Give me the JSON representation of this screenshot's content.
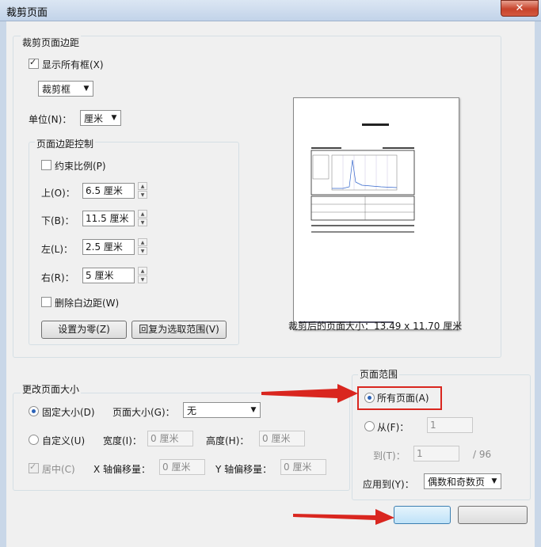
{
  "window": {
    "title": "裁剪页面",
    "close_glyph": "✕"
  },
  "margins_group": {
    "title": "裁剪页面边距",
    "show_all_boxes": {
      "label": "显示所有框(X)",
      "checked": true
    },
    "box_select": {
      "value": "裁剪框"
    },
    "unit": {
      "label": "单位(N)：",
      "value": "厘米"
    }
  },
  "margin_control": {
    "title": "页面边距控制",
    "constrain": {
      "label": "约束比例(P)",
      "checked": false
    },
    "top": {
      "label": "上(O)：",
      "value": "6.5 厘米"
    },
    "bottom": {
      "label": "下(B)：",
      "value": "11.5 厘米"
    },
    "left": {
      "label": "左(L)：",
      "value": "2.5 厘米"
    },
    "right": {
      "label": "右(R)：",
      "value": "5 厘米"
    },
    "remove_white": {
      "label": "删除白边距(W)",
      "checked": false
    },
    "set_zero_button": "设置为零(Z)",
    "revert_button": "回复为选取范围(V)"
  },
  "preview": {
    "size_text": "裁剪后的页面大小：13.49 x 11.70 厘米"
  },
  "resize_group": {
    "title": "更改页面大小",
    "fixed": {
      "label": "固定大小(D)",
      "checked": true
    },
    "page_size": {
      "label": "页面大小(G)：",
      "value": "无"
    },
    "custom": {
      "label": "自定义(U)",
      "checked": false
    },
    "width": {
      "label": "宽度(I)：",
      "value": "0 厘米"
    },
    "height": {
      "label": "高度(H)：",
      "value": "0 厘米"
    },
    "center": {
      "label": "居中(C)",
      "checked": true
    },
    "x_offset": {
      "label": "X 轴偏移量：",
      "value": "0 厘米"
    },
    "y_offset": {
      "label": "Y 轴偏移量：",
      "value": "0 厘米"
    }
  },
  "range_group": {
    "title": "页面范围",
    "all_pages": {
      "label": "所有页面(A)",
      "checked": true
    },
    "from": {
      "label": "从(F)：",
      "value": "1"
    },
    "to": {
      "label": "到(T)：",
      "value": "1",
      "total": "/ 96"
    },
    "apply_to": {
      "label": "应用到(Y)：",
      "value": "偶数和奇数页"
    }
  },
  "colors": {
    "highlight": "#d9261f",
    "accent": "#2b63b8"
  }
}
